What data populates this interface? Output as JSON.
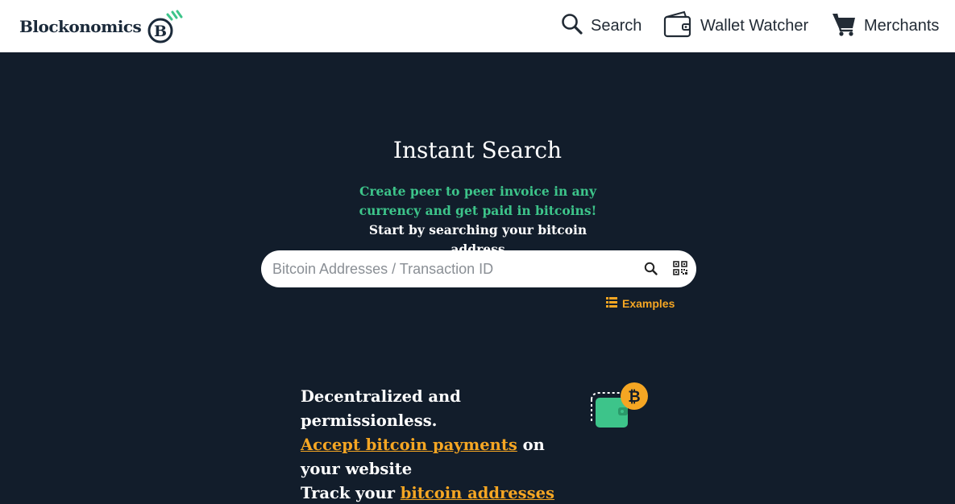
{
  "header": {
    "logo_text": "Blockonomics",
    "logo_letter": "B",
    "nav": {
      "search": "Search",
      "wallet_watcher": "Wallet Watcher",
      "merchants": "Merchants"
    }
  },
  "hero": {
    "title": "Instant Search",
    "subtitle_green": "Create peer to peer invoice in any currency and get paid in bitcoins!",
    "subtitle_white": " Start by searching your bitcoin address",
    "search_placeholder": "Bitcoin Addresses / Transaction ID",
    "examples_label": "Examples"
  },
  "features": {
    "line1": "Decentralized and permissionless.",
    "accept_link": "Accept bitcoin payments",
    "line2_rest": " on your website",
    "track_prefix": "Track your ",
    "addresses_link": "bitcoin addresses"
  },
  "colors": {
    "background": "#121d2b",
    "accent_orange": "#f5a623",
    "accent_green": "#3dc48a"
  }
}
